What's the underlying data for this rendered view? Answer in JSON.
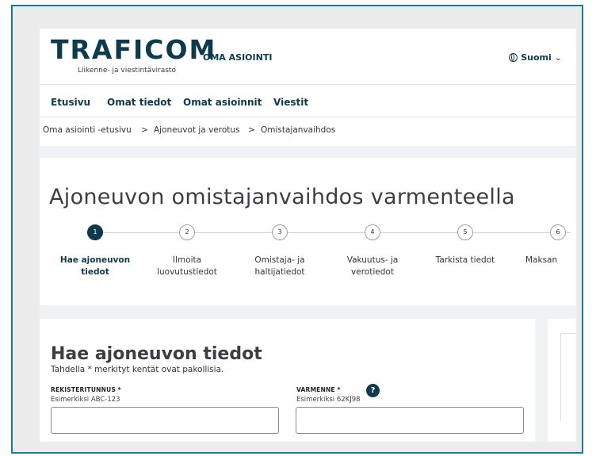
{
  "header": {
    "logo": "TRAFICOM",
    "logo_subtitle": "Liikenne- ja viestintävirasto",
    "app_name": "OMA ASIOINTI",
    "language": "Suomi",
    "language_chevron": "⌄"
  },
  "nav": {
    "items": [
      "Etusivu",
      "Omat tiedot",
      "Omat asioinnit",
      "Viestit"
    ]
  },
  "breadcrumb": {
    "items": [
      "Oma asiointi -etusivu",
      "Ajoneuvot ja verotus",
      "Omistajanvaihdos"
    ],
    "separator": ">"
  },
  "page": {
    "title": "Ajoneuvon omistajanvaihdos varmenteella"
  },
  "steps": [
    {
      "number": "1",
      "label": "Hae ajoneuvon tiedot",
      "active": true
    },
    {
      "number": "2",
      "label": "Ilmoita luovutustiedot",
      "active": false
    },
    {
      "number": "3",
      "label": "Omistaja- ja haltijatiedot",
      "active": false
    },
    {
      "number": "4",
      "label": "Vakuutus- ja verotiedot",
      "active": false
    },
    {
      "number": "5",
      "label": "Tarkista tiedot",
      "active": false
    },
    {
      "number": "6",
      "label": "Maksan",
      "active": false
    }
  ],
  "form": {
    "title": "Hae ajoneuvon tiedot",
    "required_note": "Tahdella * merkityt kentät ovat pakollisia.",
    "registration": {
      "label": "REKISTERITUNNUS *",
      "hint": "Esimerkiksi ABC-123",
      "value": ""
    },
    "certificate": {
      "label": "VARMENNE *",
      "hint": "Esimerkiksi 62KJ98",
      "value": "",
      "help": "?"
    }
  },
  "colors": {
    "brand": "#0d3a4d",
    "frame": "#1c7d96"
  }
}
